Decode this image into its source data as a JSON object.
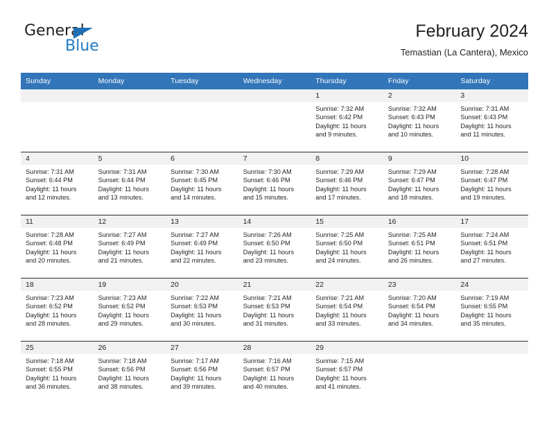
{
  "brand": {
    "name_part1": "General",
    "name_part2": "Blue",
    "flag_icon": "triangle-flag-icon",
    "accent_color": "#1f7ac4"
  },
  "header": {
    "title": "February 2024",
    "subtitle": "Temastian (La Cantera), Mexico"
  },
  "calendar": {
    "header_bg": "#3275b8",
    "daynum_bg": "#f1f1f1",
    "weekdays": [
      "Sunday",
      "Monday",
      "Tuesday",
      "Wednesday",
      "Thursday",
      "Friday",
      "Saturday"
    ],
    "weeks": [
      [
        {
          "day": "",
          "sunrise": "",
          "sunset": "",
          "daylight_line1": "",
          "daylight_line2": ""
        },
        {
          "day": "",
          "sunrise": "",
          "sunset": "",
          "daylight_line1": "",
          "daylight_line2": ""
        },
        {
          "day": "",
          "sunrise": "",
          "sunset": "",
          "daylight_line1": "",
          "daylight_line2": ""
        },
        {
          "day": "",
          "sunrise": "",
          "sunset": "",
          "daylight_line1": "",
          "daylight_line2": ""
        },
        {
          "day": "1",
          "sunrise": "Sunrise: 7:32 AM",
          "sunset": "Sunset: 6:42 PM",
          "daylight_line1": "Daylight: 11 hours",
          "daylight_line2": "and 9 minutes."
        },
        {
          "day": "2",
          "sunrise": "Sunrise: 7:32 AM",
          "sunset": "Sunset: 6:43 PM",
          "daylight_line1": "Daylight: 11 hours",
          "daylight_line2": "and 10 minutes."
        },
        {
          "day": "3",
          "sunrise": "Sunrise: 7:31 AM",
          "sunset": "Sunset: 6:43 PM",
          "daylight_line1": "Daylight: 11 hours",
          "daylight_line2": "and 11 minutes."
        }
      ],
      [
        {
          "day": "4",
          "sunrise": "Sunrise: 7:31 AM",
          "sunset": "Sunset: 6:44 PM",
          "daylight_line1": "Daylight: 11 hours",
          "daylight_line2": "and 12 minutes."
        },
        {
          "day": "5",
          "sunrise": "Sunrise: 7:31 AM",
          "sunset": "Sunset: 6:44 PM",
          "daylight_line1": "Daylight: 11 hours",
          "daylight_line2": "and 13 minutes."
        },
        {
          "day": "6",
          "sunrise": "Sunrise: 7:30 AM",
          "sunset": "Sunset: 6:45 PM",
          "daylight_line1": "Daylight: 11 hours",
          "daylight_line2": "and 14 minutes."
        },
        {
          "day": "7",
          "sunrise": "Sunrise: 7:30 AM",
          "sunset": "Sunset: 6:46 PM",
          "daylight_line1": "Daylight: 11 hours",
          "daylight_line2": "and 15 minutes."
        },
        {
          "day": "8",
          "sunrise": "Sunrise: 7:29 AM",
          "sunset": "Sunset: 6:46 PM",
          "daylight_line1": "Daylight: 11 hours",
          "daylight_line2": "and 17 minutes."
        },
        {
          "day": "9",
          "sunrise": "Sunrise: 7:29 AM",
          "sunset": "Sunset: 6:47 PM",
          "daylight_line1": "Daylight: 11 hours",
          "daylight_line2": "and 18 minutes."
        },
        {
          "day": "10",
          "sunrise": "Sunrise: 7:28 AM",
          "sunset": "Sunset: 6:47 PM",
          "daylight_line1": "Daylight: 11 hours",
          "daylight_line2": "and 19 minutes."
        }
      ],
      [
        {
          "day": "11",
          "sunrise": "Sunrise: 7:28 AM",
          "sunset": "Sunset: 6:48 PM",
          "daylight_line1": "Daylight: 11 hours",
          "daylight_line2": "and 20 minutes."
        },
        {
          "day": "12",
          "sunrise": "Sunrise: 7:27 AM",
          "sunset": "Sunset: 6:49 PM",
          "daylight_line1": "Daylight: 11 hours",
          "daylight_line2": "and 21 minutes."
        },
        {
          "day": "13",
          "sunrise": "Sunrise: 7:27 AM",
          "sunset": "Sunset: 6:49 PM",
          "daylight_line1": "Daylight: 11 hours",
          "daylight_line2": "and 22 minutes."
        },
        {
          "day": "14",
          "sunrise": "Sunrise: 7:26 AM",
          "sunset": "Sunset: 6:50 PM",
          "daylight_line1": "Daylight: 11 hours",
          "daylight_line2": "and 23 minutes."
        },
        {
          "day": "15",
          "sunrise": "Sunrise: 7:25 AM",
          "sunset": "Sunset: 6:50 PM",
          "daylight_line1": "Daylight: 11 hours",
          "daylight_line2": "and 24 minutes."
        },
        {
          "day": "16",
          "sunrise": "Sunrise: 7:25 AM",
          "sunset": "Sunset: 6:51 PM",
          "daylight_line1": "Daylight: 11 hours",
          "daylight_line2": "and 26 minutes."
        },
        {
          "day": "17",
          "sunrise": "Sunrise: 7:24 AM",
          "sunset": "Sunset: 6:51 PM",
          "daylight_line1": "Daylight: 11 hours",
          "daylight_line2": "and 27 minutes."
        }
      ],
      [
        {
          "day": "18",
          "sunrise": "Sunrise: 7:23 AM",
          "sunset": "Sunset: 6:52 PM",
          "daylight_line1": "Daylight: 11 hours",
          "daylight_line2": "and 28 minutes."
        },
        {
          "day": "19",
          "sunrise": "Sunrise: 7:23 AM",
          "sunset": "Sunset: 6:52 PM",
          "daylight_line1": "Daylight: 11 hours",
          "daylight_line2": "and 29 minutes."
        },
        {
          "day": "20",
          "sunrise": "Sunrise: 7:22 AM",
          "sunset": "Sunset: 6:53 PM",
          "daylight_line1": "Daylight: 11 hours",
          "daylight_line2": "and 30 minutes."
        },
        {
          "day": "21",
          "sunrise": "Sunrise: 7:21 AM",
          "sunset": "Sunset: 6:53 PM",
          "daylight_line1": "Daylight: 11 hours",
          "daylight_line2": "and 31 minutes."
        },
        {
          "day": "22",
          "sunrise": "Sunrise: 7:21 AM",
          "sunset": "Sunset: 6:54 PM",
          "daylight_line1": "Daylight: 11 hours",
          "daylight_line2": "and 33 minutes."
        },
        {
          "day": "23",
          "sunrise": "Sunrise: 7:20 AM",
          "sunset": "Sunset: 6:54 PM",
          "daylight_line1": "Daylight: 11 hours",
          "daylight_line2": "and 34 minutes."
        },
        {
          "day": "24",
          "sunrise": "Sunrise: 7:19 AM",
          "sunset": "Sunset: 6:55 PM",
          "daylight_line1": "Daylight: 11 hours",
          "daylight_line2": "and 35 minutes."
        }
      ],
      [
        {
          "day": "25",
          "sunrise": "Sunrise: 7:18 AM",
          "sunset": "Sunset: 6:55 PM",
          "daylight_line1": "Daylight: 11 hours",
          "daylight_line2": "and 36 minutes."
        },
        {
          "day": "26",
          "sunrise": "Sunrise: 7:18 AM",
          "sunset": "Sunset: 6:56 PM",
          "daylight_line1": "Daylight: 11 hours",
          "daylight_line2": "and 38 minutes."
        },
        {
          "day": "27",
          "sunrise": "Sunrise: 7:17 AM",
          "sunset": "Sunset: 6:56 PM",
          "daylight_line1": "Daylight: 11 hours",
          "daylight_line2": "and 39 minutes."
        },
        {
          "day": "28",
          "sunrise": "Sunrise: 7:16 AM",
          "sunset": "Sunset: 6:57 PM",
          "daylight_line1": "Daylight: 11 hours",
          "daylight_line2": "and 40 minutes."
        },
        {
          "day": "29",
          "sunrise": "Sunrise: 7:15 AM",
          "sunset": "Sunset: 6:57 PM",
          "daylight_line1": "Daylight: 11 hours",
          "daylight_line2": "and 41 minutes."
        },
        {
          "day": "",
          "sunrise": "",
          "sunset": "",
          "daylight_line1": "",
          "daylight_line2": ""
        },
        {
          "day": "",
          "sunrise": "",
          "sunset": "",
          "daylight_line1": "",
          "daylight_line2": ""
        }
      ]
    ]
  }
}
